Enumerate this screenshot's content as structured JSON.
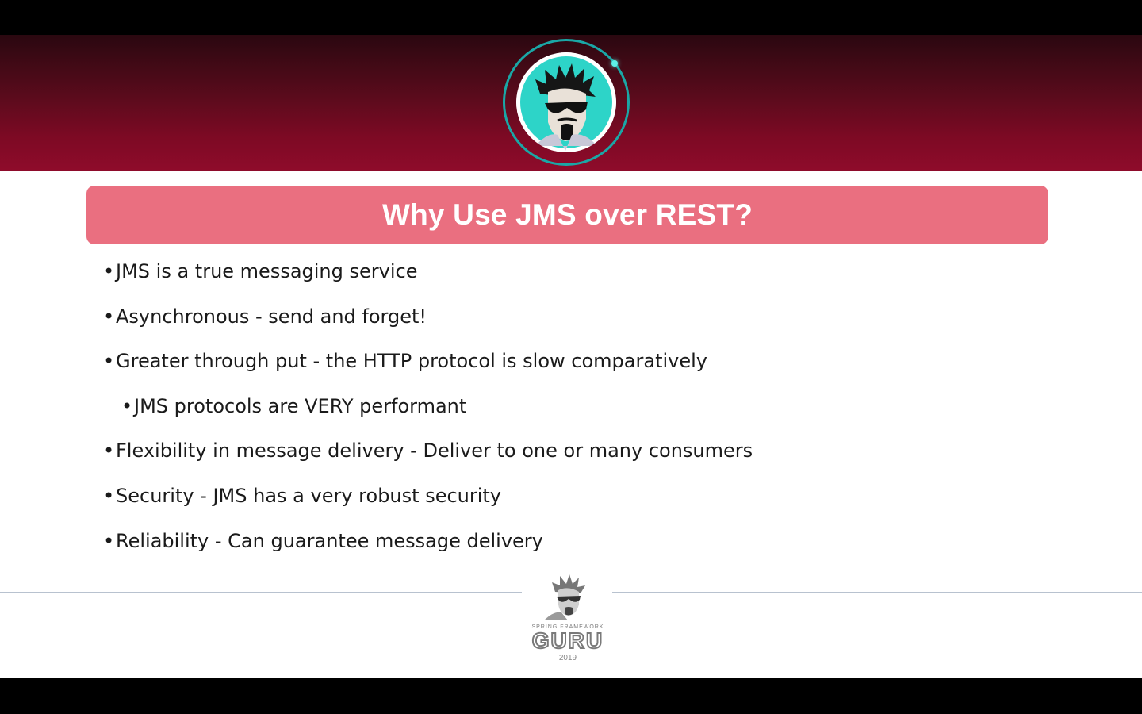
{
  "slide": {
    "title": "Why Use JMS over REST?",
    "bullets": [
      {
        "text": "JMS is a true messaging service",
        "level": 1
      },
      {
        "text": "Asynchronous - send and forget!",
        "level": 1
      },
      {
        "text": "Greater through put - the HTTP protocol is slow comparatively",
        "level": 1
      },
      {
        "text": "JMS protocols are VERY performant",
        "level": 2
      },
      {
        "text": "Flexibility in message delivery - Deliver to one or many consumers",
        "level": 1
      },
      {
        "text": "Security - JMS has a very robust security",
        "level": 1
      },
      {
        "text": "Reliability - Can guarantee message delivery",
        "level": 1
      }
    ],
    "bullet_glyph": "•"
  },
  "footer": {
    "brand_small": "SPRING FRAMEWORK",
    "brand": "GURU",
    "year": "2019"
  },
  "colors": {
    "banner_top": "#2a0810",
    "banner_bottom": "#8f0b2b",
    "title_bar": "#ea6f80",
    "ring": "#1aa7a6",
    "avatar_bg": "#2dd4c8"
  },
  "icons": {
    "header_avatar": "guru-avatar-icon",
    "footer_logo": "spring-framework-guru-logo"
  }
}
